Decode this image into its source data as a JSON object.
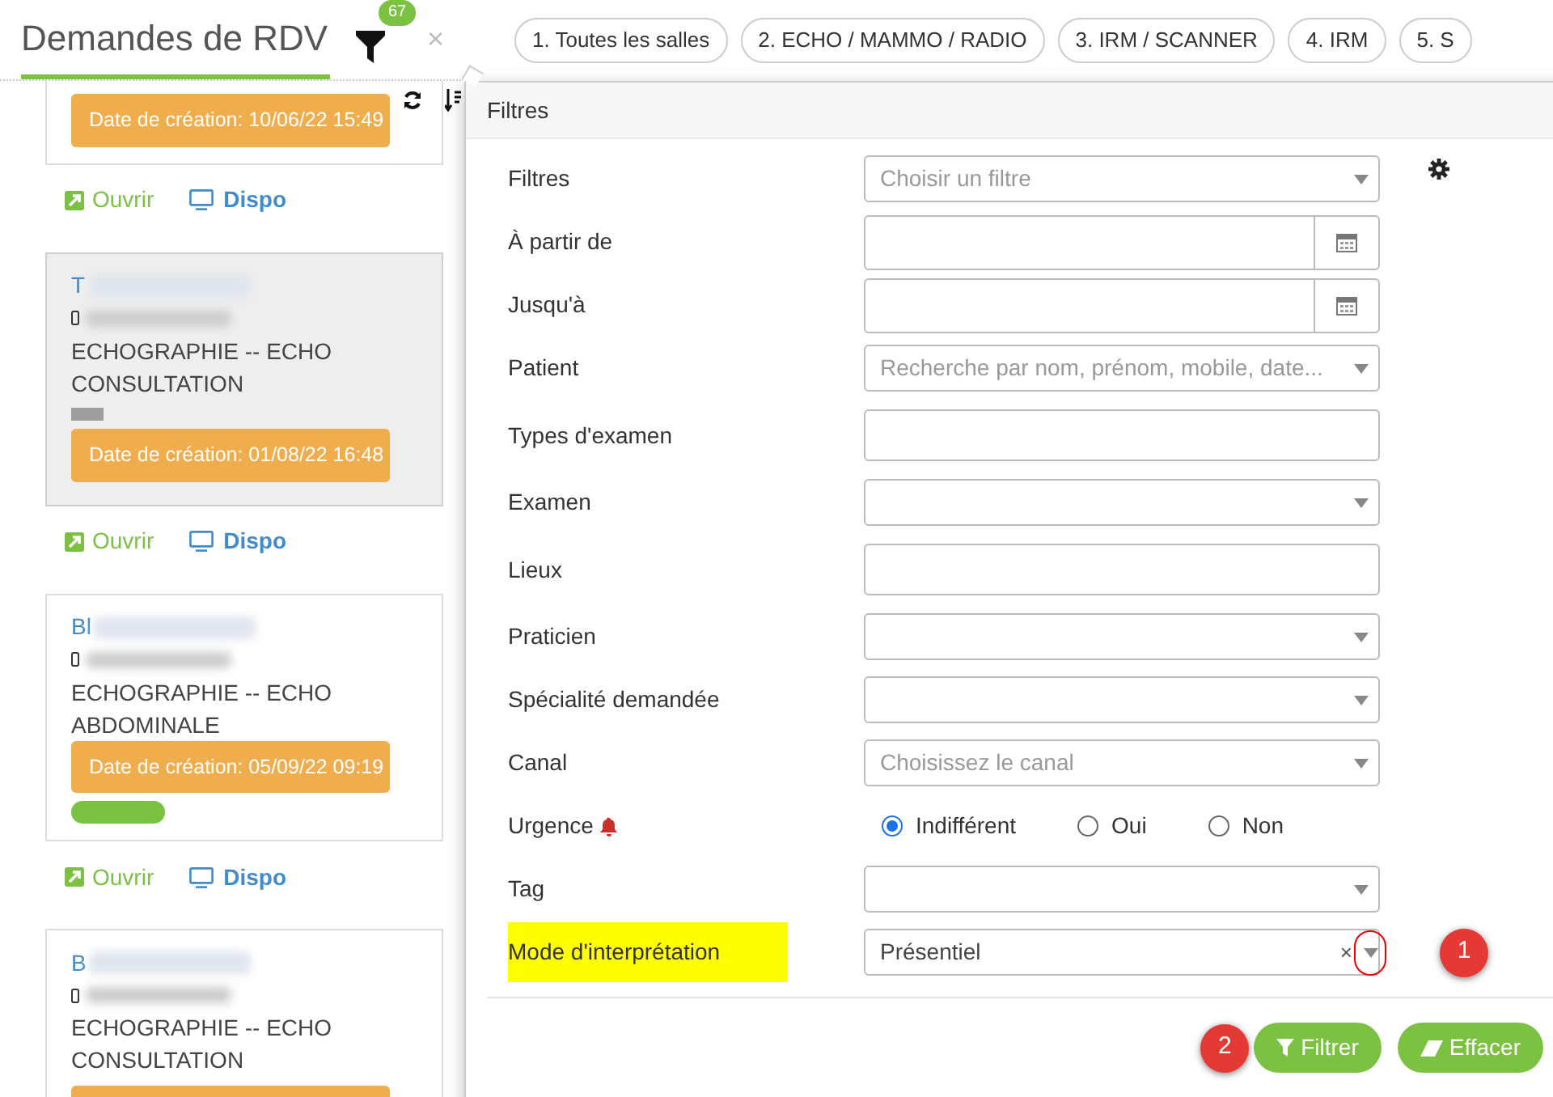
{
  "header": {
    "title": "Demandes de RDV",
    "filter_count": "67",
    "close": "×"
  },
  "room_tabs": [
    {
      "label": "1. Toutes les salles"
    },
    {
      "label": "2. ECHO / MAMMO / RADIO"
    },
    {
      "label": "3. IRM / SCANNER"
    },
    {
      "label": "4. IRM"
    },
    {
      "label": "5. S"
    }
  ],
  "cards": [
    {
      "date": "Date de création: 10/06/22 15:49",
      "selected": false,
      "actions": [
        "Ouvrir",
        "Dispo"
      ]
    },
    {
      "name": "T",
      "exam": "ECHOGRAPHIE -- ECHO CONSULTATION",
      "color": "#9e9e9e",
      "date": "Date de création: 01/08/22 16:48",
      "selected": true,
      "actions": [
        "Ouvrir",
        "Dispo"
      ]
    },
    {
      "name": "Bl",
      "exam": "ECHOGRAPHIE -- ECHO ABDOMINALE",
      "date": "Date de création: 05/09/22 09:19",
      "color": "#7cc242",
      "selected": false,
      "actions": [
        "Ouvrir",
        "Dispo"
      ]
    },
    {
      "name": "B",
      "exam": "ECHOGRAPHIE -- ECHO CONSULTATION",
      "selected": false
    }
  ],
  "filters_panel": {
    "title": "Filtres",
    "fields": [
      {
        "label": "Filtres",
        "kind": "select",
        "placeholder": "Choisir un filtre",
        "gear": true
      },
      {
        "label": "À partir de",
        "kind": "date"
      },
      {
        "label": "Jusqu'à",
        "kind": "date"
      },
      {
        "label": "Patient",
        "kind": "select",
        "placeholder": "Recherche par nom, prénom, mobile, date..."
      },
      {
        "label": "Types d'examen",
        "kind": "text"
      },
      {
        "label": "Examen",
        "kind": "select"
      },
      {
        "label": "Lieux",
        "kind": "text"
      },
      {
        "label": "Praticien",
        "kind": "select"
      },
      {
        "label": "Spécialité demandée",
        "kind": "select"
      },
      {
        "label": "Canal",
        "kind": "select",
        "placeholder": "Choisissez le canal"
      },
      {
        "label": "Urgence",
        "kind": "radio",
        "bell": true,
        "options": [
          {
            "label": "Indifférent",
            "selected": true
          },
          {
            "label": "Oui",
            "selected": false
          },
          {
            "label": "Non",
            "selected": false
          }
        ]
      },
      {
        "label": "Tag",
        "kind": "select"
      },
      {
        "label": "Mode d'interprétation",
        "kind": "select",
        "value": "Présentiel",
        "clear": "×",
        "highlighted": true,
        "annotation": "1"
      }
    ],
    "buttons": [
      {
        "label": "Filtrer",
        "kind": "filter",
        "annotation": "2"
      },
      {
        "label": "Effacer",
        "kind": "clear"
      }
    ]
  }
}
